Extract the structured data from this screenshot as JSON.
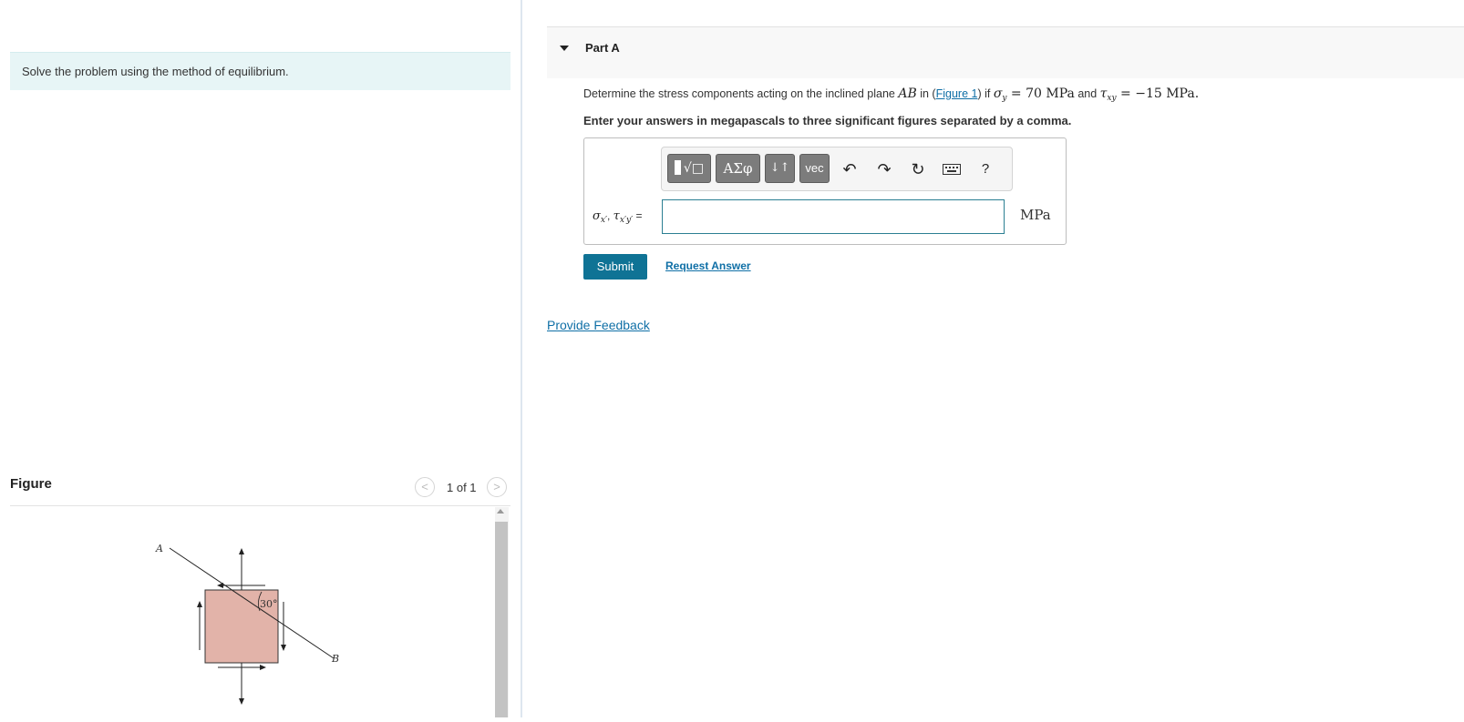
{
  "left_panel": {
    "instruction": "Solve the problem using the method of equilibrium.",
    "figure": {
      "title": "Figure",
      "pager": "1 of 1",
      "prev_icon": "chevron-left-icon",
      "next_icon": "chevron-right-icon",
      "labels": {
        "point_a": "A",
        "point_b": "B",
        "angle": "30°"
      },
      "element_fill": "#e2b3a9"
    }
  },
  "part": {
    "title": "Part A",
    "question": {
      "prefix": "Determine the stress components acting on the inclined plane ",
      "plane": "AB",
      "in_text": " in (",
      "figure_link": "Figure 1",
      "if_text": ") if ",
      "sigma": "σ",
      "sigma_sub": "y",
      "eq1": " = 70 MPa",
      "and_text": " and ",
      "tau": "τ",
      "tau_sub": "xy",
      "eq2": " = −15 MPa",
      "end": "."
    },
    "instruction": "Enter your answers in megapascals to three significant figures separated by a comma.",
    "toolbar": {
      "templates_label": "√□",
      "greek_label": "ΑΣφ",
      "arrows_label": "↓↑",
      "vec_label": "vec",
      "undo_icon": "undo-icon",
      "redo_icon": "redo-icon",
      "reset_icon": "reset-icon",
      "keyboard_icon": "keyboard-icon",
      "help_label": "?"
    },
    "answer": {
      "label_sigma": "σ",
      "label_sigma_sub": "x′",
      "label_sep": ", ",
      "label_tau": "τ",
      "label_tau_sub": "x′y′",
      "label_eq": " =",
      "value": "",
      "units": "MPa"
    },
    "submit_label": "Submit",
    "request_label": "Request Answer"
  },
  "feedback_label": "Provide Feedback",
  "colors": {
    "accent": "#0f7395",
    "link": "#0f6fa6",
    "instruction_bg": "#e7f5f6"
  }
}
